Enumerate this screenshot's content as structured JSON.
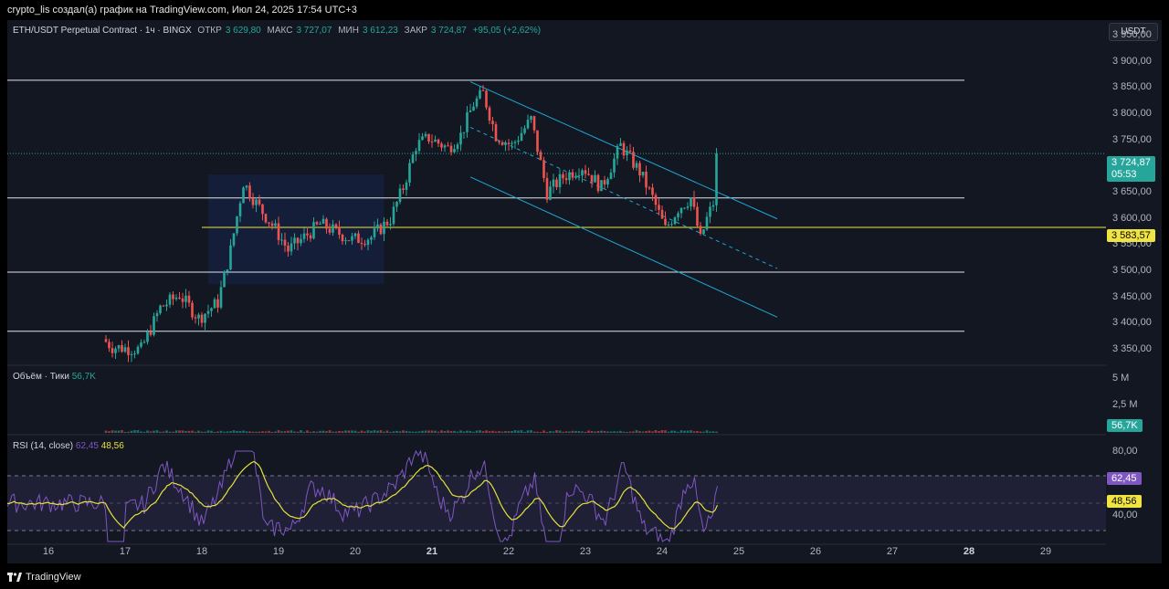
{
  "header": {
    "attribution": "crypto_lis создал(а) график на TradingView.com, Июл 24, 2025 17:54 UTC+3"
  },
  "legend": {
    "symbol": "ETH/USDT Perpetual Contract · 1ч · BINGX",
    "open_label": "ОТКР",
    "open": "3 629,80",
    "high_label": "МАКС",
    "high": "3 727,07",
    "low_label": "МИН",
    "low": "3 612,23",
    "close_label": "ЗАКР",
    "close": "3 724,87",
    "change": "+95,05 (+2,62%)"
  },
  "currency_button": "USDT",
  "price_axis": {
    "ticks": [
      "3 950,00",
      "3 900,00",
      "3 850,00",
      "3 800,00",
      "3 750,00",
      "3 650,00",
      "3 600,00",
      "3 550,00",
      "3 500,00",
      "3 450,00",
      "3 400,00",
      "3 350,00"
    ],
    "current_price": "3 724,87",
    "countdown": "05:53",
    "level_price": "3 583,57"
  },
  "volume": {
    "label": "Объём · Тики",
    "value": "56,7K",
    "ticks": [
      "5 M",
      "2,5 M"
    ],
    "badge": "56,7K"
  },
  "rsi": {
    "label": "RSI (14, close)",
    "value": "62,45",
    "ma_value": "48,56",
    "ticks": [
      "80,00",
      "40,00"
    ],
    "badge": "62,45",
    "ma_badge": "48,56"
  },
  "time_axis": {
    "labels": [
      "16",
      "17",
      "18",
      "19",
      "20",
      "21",
      "22",
      "23",
      "24",
      "25",
      "26",
      "27",
      "28",
      "29"
    ]
  },
  "footer": {
    "brand": "TradingView"
  },
  "colors": {
    "up": "#26a69a",
    "down": "#ef5350",
    "channel": "#1ea7d6",
    "level": "#f0e442",
    "rsi": "#7e57c2",
    "rsi_ma": "#e4e23a"
  },
  "chart_data": {
    "type": "candlestick",
    "symbol": "ETH/USDT",
    "timeframe": "1h",
    "ylim": [
      3320,
      3980
    ],
    "horizontal_levels": [
      3865,
      3640,
      3498,
      3385
    ],
    "key_level": 3583.57,
    "channel_upper": [
      [
        "2025-07-21 12:00",
        3862
      ],
      [
        "2025-07-25 12:00",
        3600
      ]
    ],
    "channel_mid": [
      [
        "2025-07-21 12:00",
        3775
      ],
      [
        "2025-07-25 12:00",
        3505
      ]
    ],
    "channel_lower": [
      [
        "2025-07-21 12:00",
        3680
      ],
      [
        "2025-07-25 12:00",
        3412
      ]
    ],
    "price_path": [
      [
        "2025-07-16 18:00",
        3370
      ],
      [
        "2025-07-16 21:00",
        3355
      ],
      [
        "2025-07-17 06:00",
        3350
      ],
      [
        "2025-07-17 12:00",
        3430
      ],
      [
        "2025-07-17 18:00",
        3455
      ],
      [
        "2025-07-18 00:00",
        3410
      ],
      [
        "2025-07-18 06:00",
        3440
      ],
      [
        "2025-07-18 10:00",
        3540
      ],
      [
        "2025-07-18 14:00",
        3670
      ],
      [
        "2025-07-18 18:00",
        3630
      ],
      [
        "2025-07-19 00:00",
        3580
      ],
      [
        "2025-07-19 04:00",
        3540
      ],
      [
        "2025-07-19 08:00",
        3560
      ],
      [
        "2025-07-19 14:00",
        3590
      ],
      [
        "2025-07-20 00:00",
        3560
      ],
      [
        "2025-07-20 06:00",
        3565
      ],
      [
        "2025-07-20 12:00",
        3600
      ],
      [
        "2025-07-20 16:00",
        3660
      ],
      [
        "2025-07-20 20:00",
        3740
      ],
      [
        "2025-07-21 00:00",
        3755
      ],
      [
        "2025-07-21 06:00",
        3735
      ],
      [
        "2025-07-21 10:00",
        3760
      ],
      [
        "2025-07-21 14:00",
        3820
      ],
      [
        "2025-07-21 17:00",
        3840
      ],
      [
        "2025-07-21 21:00",
        3760
      ],
      [
        "2025-07-22 02:00",
        3740
      ],
      [
        "2025-07-22 08:00",
        3790
      ],
      [
        "2025-07-22 13:00",
        3650
      ],
      [
        "2025-07-22 18:00",
        3680
      ],
      [
        "2025-07-23 00:00",
        3700
      ],
      [
        "2025-07-23 06:00",
        3660
      ],
      [
        "2025-07-23 12:00",
        3740
      ],
      [
        "2025-07-23 18:00",
        3690
      ],
      [
        "2025-07-23 22:00",
        3640
      ],
      [
        "2025-07-24 02:00",
        3580
      ],
      [
        "2025-07-24 06:00",
        3620
      ],
      [
        "2025-07-24 10:00",
        3640
      ],
      [
        "2025-07-24 13:00",
        3560
      ],
      [
        "2025-07-24 15:00",
        3600
      ],
      [
        "2025-07-24 17:00",
        3630
      ],
      [
        "2025-07-24 17:54",
        3724.87
      ]
    ],
    "rsi_series": {
      "name": "RSI (14, close)",
      "last": 62.45
    },
    "rsi_ma_series": {
      "last": 48.56
    },
    "rsi_ylim": [
      20,
      100
    ],
    "rsi_band": [
      70,
      30
    ]
  }
}
